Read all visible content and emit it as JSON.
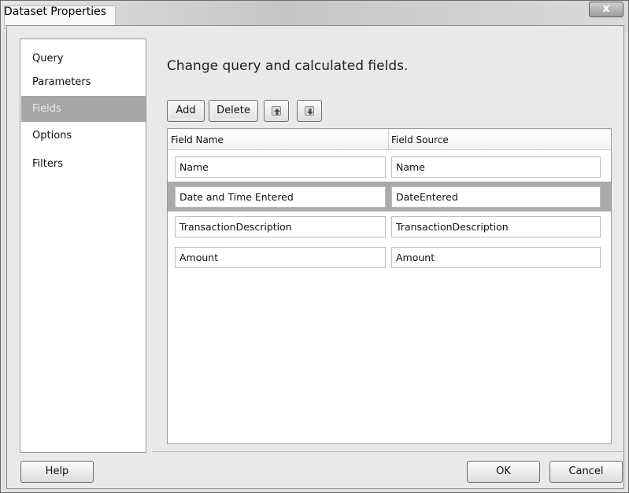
{
  "window": {
    "title": "Dataset Properties",
    "close_glyph": "x"
  },
  "nav": {
    "items": [
      {
        "label": "Query",
        "selected": false
      },
      {
        "label": "Parameters",
        "selected": false
      },
      {
        "label": "Fields",
        "selected": true
      },
      {
        "label": "Options",
        "selected": false
      },
      {
        "label": "Filters",
        "selected": false
      }
    ]
  },
  "main": {
    "heading": "Change query and calculated fields.",
    "toolbar": {
      "add_label": "Add",
      "delete_label": "Delete",
      "move_up_icon": "arrow-up-icon",
      "move_down_icon": "arrow-down-icon"
    },
    "grid": {
      "columns": [
        "Field Name",
        "Field Source"
      ],
      "rows": [
        {
          "field_name": "Name",
          "field_source": "Name",
          "selected": false
        },
        {
          "field_name": "Date and Time Entered",
          "field_source": "DateEntered",
          "selected": true
        },
        {
          "field_name": "TransactionDescription",
          "field_source": "TransactionDescription",
          "selected": false
        },
        {
          "field_name": "Amount",
          "field_source": "Amount",
          "selected": false
        }
      ]
    }
  },
  "footer": {
    "help_label": "Help",
    "ok_label": "OK",
    "cancel_label": "Cancel"
  },
  "colors": {
    "nav_selected_bg": "#a6a6a6",
    "row_selected_bg": "#aaaaaa",
    "window_bg": "#e9e9e9"
  }
}
